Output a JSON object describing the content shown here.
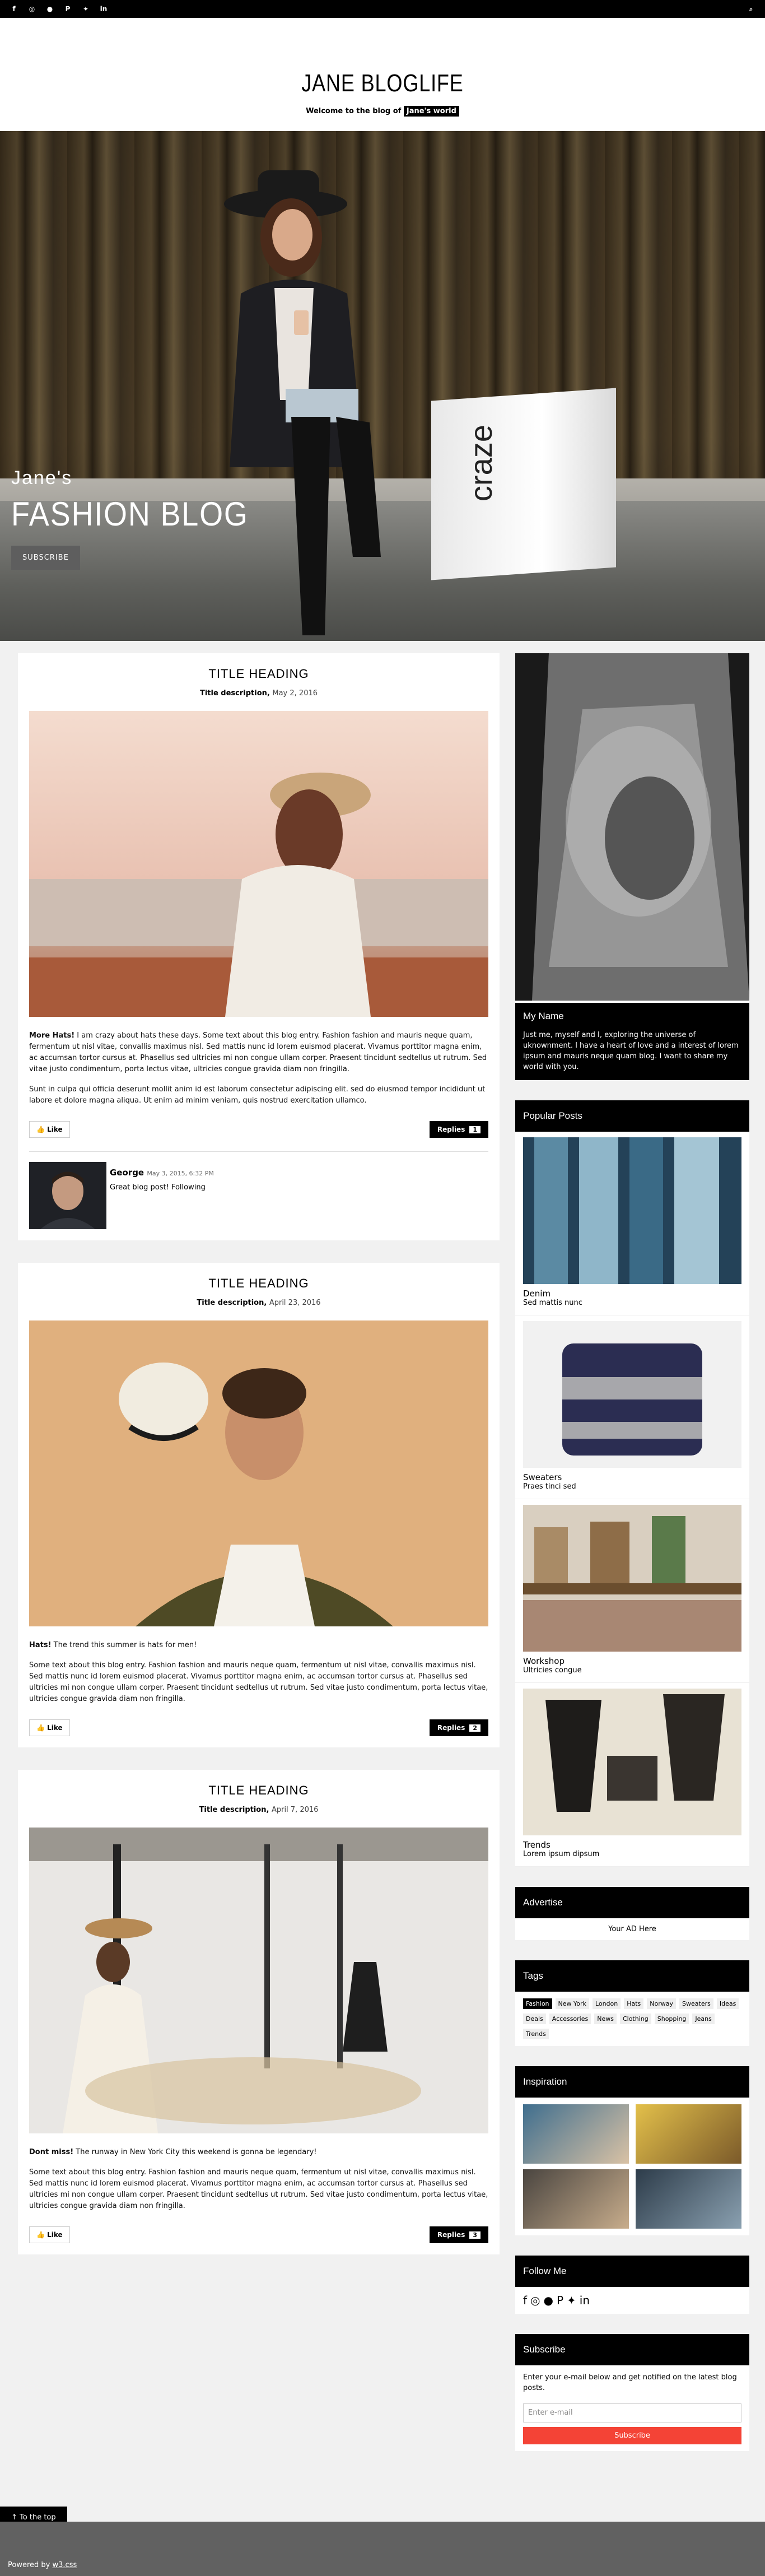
{
  "topbar": {
    "social_icons": [
      {
        "name": "facebook-icon",
        "glyph": "f"
      },
      {
        "name": "instagram-icon",
        "glyph": "◎"
      },
      {
        "name": "snapchat-icon",
        "glyph": "●"
      },
      {
        "name": "pinterest-icon",
        "glyph": "P"
      },
      {
        "name": "twitter-icon",
        "glyph": "✦"
      },
      {
        "name": "linkedin-icon",
        "glyph": "in"
      }
    ],
    "search_glyph": "⌕"
  },
  "header": {
    "title": "JANE BLOGLIFE",
    "welcome": "Welcome to the blog of",
    "welcome_tag": "Jane's world"
  },
  "hero": {
    "small": "Jane's",
    "big": "FASHION BLOG",
    "button": "SUBSCRIBE",
    "bag_brand": "craze"
  },
  "posts": [
    {
      "title": "TITLE HEADING",
      "desc": "Title description,",
      "date": "May 2, 2016",
      "lead": "More Hats!",
      "text1": " I am crazy about hats these days. Some text about this blog entry. Fashion fashion and mauris neque quam, fermentum ut nisl vitae, convallis maximus nisl. Sed mattis nunc id lorem euismod placerat. Vivamus porttitor magna enim, ac accumsan tortor cursus at. Phasellus sed ultricies mi non congue ullam corper. Praesent tincidunt sedtellus ut rutrum. Sed vitae justo condimentum, porta lectus vitae, ultricies congue gravida diam non fringilla.",
      "text2": "Sunt in culpa qui officia deserunt mollit anim id est laborum consectetur adipiscing elit. sed do eiusmod tempor incididunt ut labore et dolore magna aliqua. Ut enim ad minim veniam, quis nostrud exercitation ullamco.",
      "like": "Like",
      "replies": "Replies",
      "replies_count": "1",
      "comment": {
        "name": "George",
        "time": "May 3, 2015, 6:32 PM",
        "text": "Great blog post! Following"
      }
    },
    {
      "title": "TITLE HEADING",
      "desc": "Title description,",
      "date": "April 23, 2016",
      "lead": "Hats!",
      "lead_rest": " The trend this summer is hats for men!",
      "text1": "Some text about this blog entry. Fashion fashion and mauris neque quam, fermentum ut nisl vitae, convallis maximus nisl. Sed mattis nunc id lorem euismod placerat. Vivamus porttitor magna enim, ac accumsan tortor cursus at. Phasellus sed ultricies mi non congue ullam corper. Praesent tincidunt sedtellus ut rutrum. Sed vitae justo condimentum, porta lectus vitae, ultricies congue gravida diam non fringilla.",
      "like": "Like",
      "replies": "Replies",
      "replies_count": "2"
    },
    {
      "title": "TITLE HEADING",
      "desc": "Title description,",
      "date": "April 7, 2016",
      "lead": "Dont miss!",
      "lead_rest": " The runway in New York City this weekend is gonna be legendary!",
      "text1": "Some text about this blog entry. Fashion fashion and mauris neque quam, fermentum ut nisl vitae, convallis maximus nisl. Sed mattis nunc id lorem euismod placerat. Vivamus porttitor magna enim, ac accumsan tortor cursus at. Phasellus sed ultricies mi non congue ullam corper. Praesent tincidunt sedtellus ut rutrum. Sed vitae justo condimentum, porta lectus vitae, ultricies congue gravida diam non fringilla.",
      "like": "Like",
      "replies": "Replies",
      "replies_count": "3"
    }
  ],
  "sidebar": {
    "myname": {
      "title": "My Name",
      "text": "Just me, myself and I, exploring the universe of uknownment. I have a heart of love and a interest of lorem ipsum and mauris neque quam blog. I want to share my world with you."
    },
    "popular": {
      "title": "Popular Posts",
      "items": [
        {
          "title": "Denim",
          "sub": "Sed mattis nunc"
        },
        {
          "title": "Sweaters",
          "sub": "Praes tinci sed"
        },
        {
          "title": "Workshop",
          "sub": "Ultricies congue"
        },
        {
          "title": "Trends",
          "sub": "Lorem ipsum dipsum"
        }
      ]
    },
    "advertise": {
      "title": "Advertise",
      "text": "Your AD Here"
    },
    "tags": {
      "title": "Tags",
      "items": [
        "Fashion",
        "New York",
        "London",
        "Hats",
        "Norway",
        "Sweaters",
        "Ideas",
        "Deals",
        "Accessories",
        "News",
        "Clothing",
        "Shopping",
        "Jeans",
        "Trends"
      ]
    },
    "inspiration": {
      "title": "Inspiration"
    },
    "follow": {
      "title": "Follow Me",
      "icons": [
        "facebook-icon",
        "instagram-icon",
        "snapchat-icon",
        "pinterest-icon",
        "twitter-icon",
        "linkedin-icon"
      ],
      "glyphs": [
        "f",
        "◎",
        "●",
        "P",
        "✦",
        "in"
      ]
    },
    "subscribe": {
      "title": "Subscribe",
      "text": "Enter your e-mail below and get notified on the latest blog posts.",
      "placeholder": "Enter e-mail",
      "button": "Subscribe"
    }
  },
  "totop": "To the top",
  "footer": {
    "powered": "Powered by",
    "brand": "w3.css"
  }
}
